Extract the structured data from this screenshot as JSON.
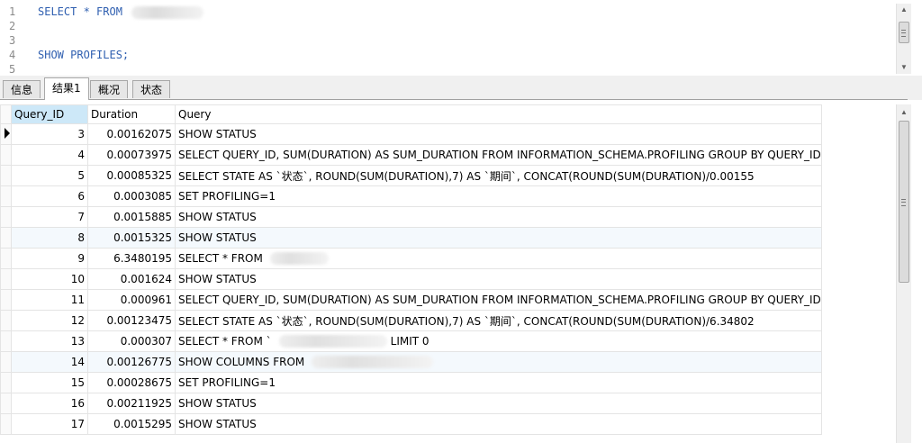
{
  "editor": {
    "lines": [
      {
        "num": "1",
        "text": "SELECT * FROM",
        "redacted": true
      },
      {
        "num": "2",
        "text": ""
      },
      {
        "num": "3",
        "text": ""
      },
      {
        "num": "4",
        "text": "SHOW PROFILES;"
      },
      {
        "num": "5",
        "text": ""
      }
    ],
    "code_color": "#2f5fb0"
  },
  "tabs": [
    {
      "label": "信息",
      "active": false
    },
    {
      "label": "结果1",
      "active": true
    },
    {
      "label": "概况",
      "active": false
    },
    {
      "label": "状态",
      "active": false
    }
  ],
  "grid": {
    "columns": [
      "Query_ID",
      "Duration",
      "Query"
    ],
    "rows": [
      {
        "id": "3",
        "duration": "0.00162075",
        "query": "SHOW STATUS",
        "current": true
      },
      {
        "id": "4",
        "duration": "0.00073975",
        "query": "SELECT QUERY_ID, SUM(DURATION) AS SUM_DURATION FROM INFORMATION_SCHEMA.PROFILING GROUP BY QUERY_ID"
      },
      {
        "id": "5",
        "duration": "0.00085325",
        "query": "SELECT STATE AS `状态`, ROUND(SUM(DURATION),7) AS `期间`, CONCAT(ROUND(SUM(DURATION)/0.00155"
      },
      {
        "id": "6",
        "duration": "0.0003085",
        "query": "SET PROFILING=1"
      },
      {
        "id": "7",
        "duration": "0.0015885",
        "query": "SHOW STATUS"
      },
      {
        "id": "8",
        "duration": "0.0015325",
        "query": "SHOW STATUS",
        "highlight": true
      },
      {
        "id": "9",
        "duration": "6.3480195",
        "query": "SELECT * FROM",
        "redacted": true
      },
      {
        "id": "10",
        "duration": "0.001624",
        "query": "SHOW STATUS"
      },
      {
        "id": "11",
        "duration": "0.000961",
        "query": "SELECT QUERY_ID, SUM(DURATION) AS SUM_DURATION FROM INFORMATION_SCHEMA.PROFILING GROUP BY QUERY_ID"
      },
      {
        "id": "12",
        "duration": "0.00123475",
        "query": "SELECT STATE AS `状态`, ROUND(SUM(DURATION),7) AS `期间`, CONCAT(ROUND(SUM(DURATION)/6.34802"
      },
      {
        "id": "13",
        "duration": "0.000307",
        "query": "SELECT * FROM `",
        "redacted": true,
        "suffix": "LIMIT 0"
      },
      {
        "id": "14",
        "duration": "0.00126775",
        "query": "SHOW COLUMNS FROM",
        "redacted": true,
        "highlight": true
      },
      {
        "id": "15",
        "duration": "0.00028675",
        "query": "SET PROFILING=1"
      },
      {
        "id": "16",
        "duration": "0.00211925",
        "query": "SHOW STATUS"
      },
      {
        "id": "17",
        "duration": "0.0015295",
        "query": "SHOW STATUS"
      }
    ]
  },
  "colors": {
    "header_selected": "#cde8f8",
    "row_highlight": "#f4f9fd"
  }
}
